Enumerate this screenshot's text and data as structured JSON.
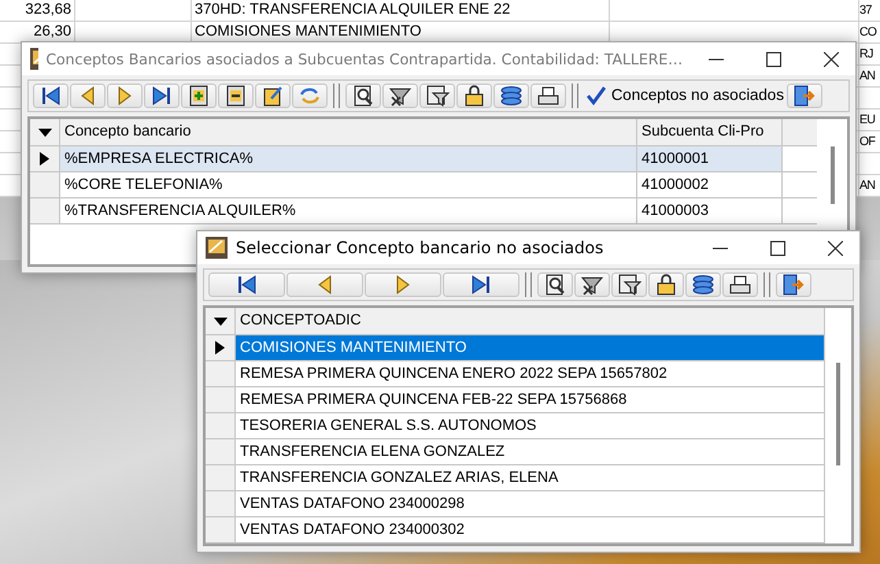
{
  "background_sheet": {
    "rows": [
      {
        "column_1": "323,68",
        "column_3": "370HD: TRANSFERENCIA ALQUILER ENE 22",
        "column_5": "37"
      },
      {
        "column_1": "26,30",
        "column_3": "COMISIONES MANTENIMIENTO",
        "column_5": "CO"
      },
      {
        "column_5": "RJ"
      },
      {
        "column_5": "AN"
      },
      {},
      {
        "column_5": "EU"
      },
      {
        "column_5": "OF"
      },
      {},
      {
        "column_5": "AN"
      }
    ]
  },
  "windows": [
    {
      "title": "Conceptos Bancarios asociados a Subcuentas Contrapartida. Contabilidad: TALLERE…",
      "active": false,
      "toolbar_button": {
        "label": "Conceptos no asociados"
      },
      "table": {
        "columns": [
          "Concepto bancario",
          "Subcuenta Cli-Pro"
        ],
        "rows": [
          {
            "cells": [
              "%EMPRESA ELECTRICA%",
              "41000001"
            ],
            "selected": true
          },
          {
            "cells": [
              "%CORE TELEFONIA%",
              "41000002"
            ],
            "selected": false
          },
          {
            "cells": [
              "%TRANSFERENCIA ALQUILER%",
              "41000003"
            ],
            "selected": false
          }
        ]
      }
    },
    {
      "title": "Seleccionar Concepto bancario no asociados",
      "active": true,
      "table": {
        "columns": [
          "CONCEPTOADIC"
        ],
        "rows": [
          {
            "cells": [
              "COMISIONES MANTENIMIENTO"
            ],
            "selected": true
          },
          {
            "cells": [
              "REMESA PRIMERA QUINCENA ENERO 2022 SEPA 15657802"
            ],
            "selected": false
          },
          {
            "cells": [
              "REMESA PRIMERA QUINCENA FEB-22 SEPA 15756868"
            ],
            "selected": false
          },
          {
            "cells": [
              "TESORERIA GENERAL S.S. AUTONOMOS"
            ],
            "selected": false
          },
          {
            "cells": [
              "TRANSFERENCIA ELENA GONZALEZ"
            ],
            "selected": false
          },
          {
            "cells": [
              "TRANSFERENCIA GONZALEZ ARIAS, ELENA"
            ],
            "selected": false
          },
          {
            "cells": [
              "VENTAS DATAFONO 234000298"
            ],
            "selected": false
          },
          {
            "cells": [
              "VENTAS DATAFONO 234000302"
            ],
            "selected": false
          }
        ]
      }
    }
  ]
}
